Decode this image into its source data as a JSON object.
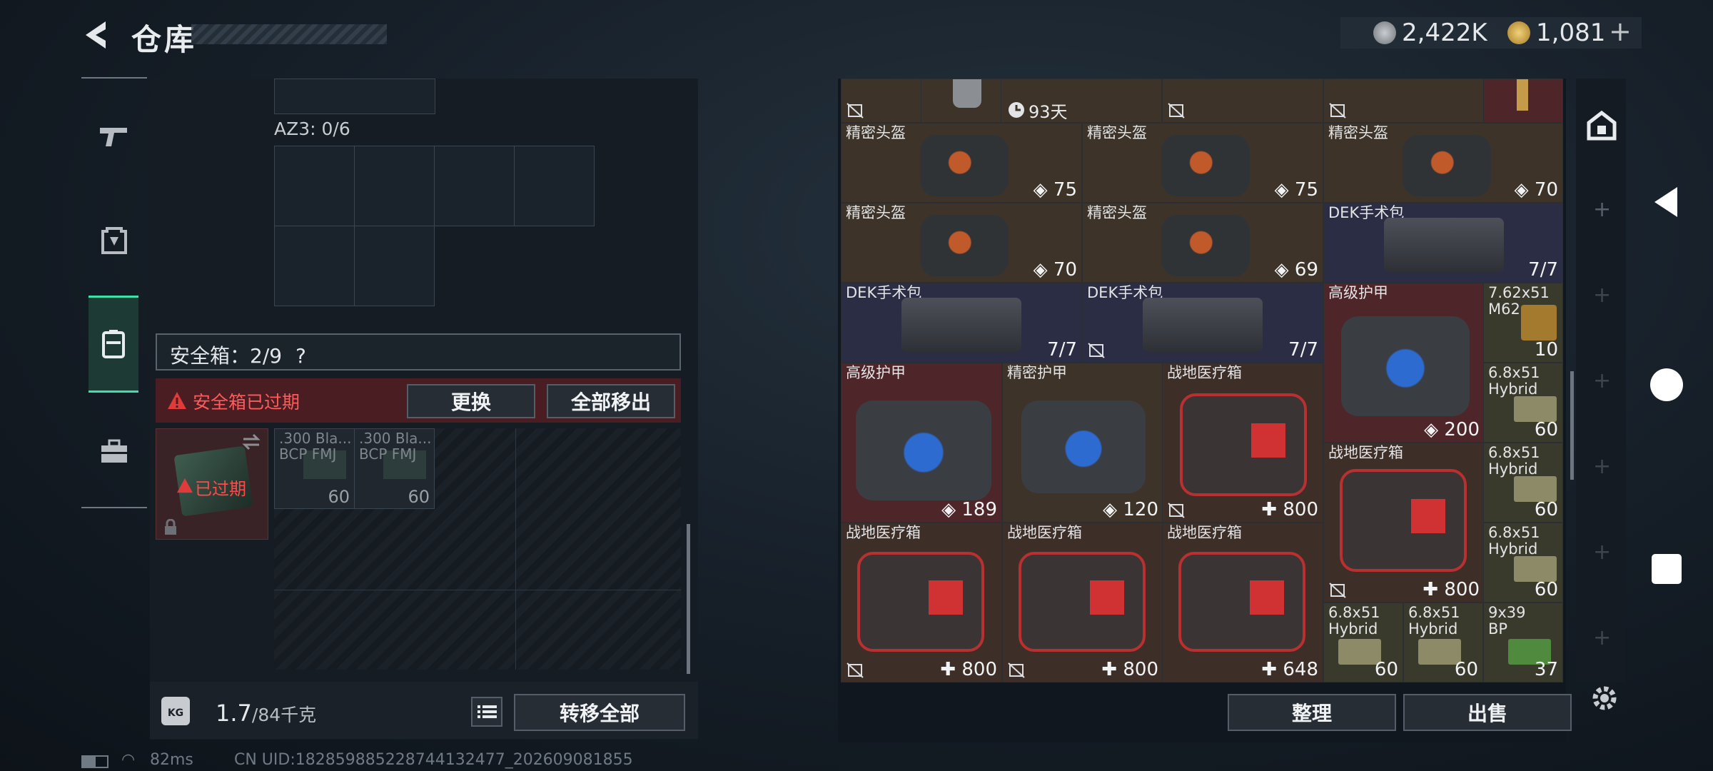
{
  "header": {
    "title": "仓库",
    "currency1": "2,422K",
    "currency2": "1,081",
    "plus": "+"
  },
  "sidebar": {
    "items": [
      "gun-icon",
      "backpack-icon",
      "case-icon",
      "toolbox-icon"
    ]
  },
  "left": {
    "az3_label": "AZ3: 0/6",
    "safebox_label": "安全箱：2/9",
    "safebox_help": "?",
    "expired_text": "安全箱已过期",
    "btn_replace": "更换",
    "btn_remove_all": "全部移出",
    "case_expired": "已过期",
    "ammo": [
      {
        "name": ".300 Bla...",
        "sub": "BCP FMJ",
        "count": "60"
      },
      {
        "name": ".300 Bla...",
        "sub": "BCP FMJ",
        "count": "60"
      }
    ],
    "weight": "1.7",
    "weight_cap": "/84千克",
    "btn_transfer": "转移全部"
  },
  "right": {
    "top_row_days": "93天",
    "items": [
      {
        "name": "精密头盔",
        "val": "75"
      },
      {
        "name": "精密头盔",
        "val": "75"
      },
      {
        "name": "精密头盔",
        "val": "70"
      },
      {
        "name": "精密头盔",
        "val": "70"
      },
      {
        "name": "精密头盔",
        "val": "69"
      },
      {
        "name": "DEK手术包",
        "val": "7/7"
      },
      {
        "name": "DEK手术包",
        "val": "7/7"
      },
      {
        "name": "DEK手术包",
        "val": "7/7"
      },
      {
        "name": "高级护甲",
        "val": "200"
      },
      {
        "name": "7.62x51\nM62",
        "val": "10"
      },
      {
        "name": "高级护甲",
        "val": "189"
      },
      {
        "name": "精密护甲",
        "val": "120"
      },
      {
        "name": "战地医疗箱",
        "val": "800"
      },
      {
        "name": "6.8x51\nHybrid",
        "val": "60"
      },
      {
        "name": "战地医疗箱",
        "val": "800"
      },
      {
        "name": "6.8x51\nHybrid",
        "val": "60"
      },
      {
        "name": "6.8x51\nHybrid",
        "val": "60"
      },
      {
        "name": "战地医疗箱",
        "val": "800"
      },
      {
        "name": "战地医疗箱",
        "val": "800"
      },
      {
        "name": "战地医疗箱",
        "val": "648"
      },
      {
        "name": "6.8x51\nHybrid",
        "val": "60"
      },
      {
        "name": "6.8x51\nHybrid",
        "val": "60"
      },
      {
        "name": "9x39\nBP",
        "val": "37"
      }
    ],
    "btn_sort": "整理",
    "btn_sell": "出售"
  },
  "status": {
    "ping": "82ms",
    "uid": "CN UID:182859885228744132477_202609081855"
  },
  "colors": {
    "accent": "#3de0a8",
    "expired": "#e03a3a"
  }
}
